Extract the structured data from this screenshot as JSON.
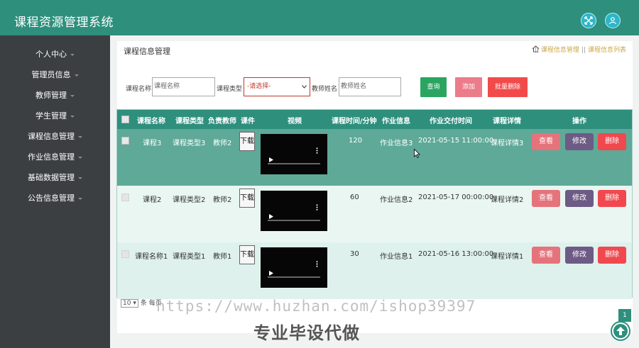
{
  "app": {
    "title": "课程资源管理系统"
  },
  "header": {
    "fullscreen_icon": "expand-icon",
    "user_icon": "user-icon"
  },
  "sidebar": {
    "items": [
      {
        "label": "个人中心"
      },
      {
        "label": "管理员信息"
      },
      {
        "label": "教师管理"
      },
      {
        "label": "学生管理"
      },
      {
        "label": "课程信息管理"
      },
      {
        "label": "作业信息管理"
      },
      {
        "label": "基础数据管理"
      },
      {
        "label": "公告信息管理"
      }
    ]
  },
  "page": {
    "title": "课程信息管理",
    "breadcrumb": [
      "课程信息管理",
      "课程信息列表"
    ]
  },
  "search": {
    "course_name_label": "课程名称",
    "course_name_placeholder": "课程名称",
    "course_type_label": "课程类型",
    "course_type_value": "-请选择-",
    "teacher_label": "教师姓名",
    "teacher_placeholder": "教师姓名",
    "query_label": "查询",
    "add_label": "添加",
    "batch_delete_label": "批量删除"
  },
  "table": {
    "headers": [
      "课程名称",
      "课程类型",
      "负责教师",
      "课件",
      "视频",
      "课程时间/分钟",
      "作业信息",
      "作业交付时间",
      "课程详情",
      "操作"
    ],
    "rows": [
      {
        "name": "课程3",
        "type": "课程类型3",
        "teacher": "教师2",
        "download": "下载",
        "minutes": "120",
        "homework": "作业信息3",
        "deadline": "2021-05-15 11:00:00",
        "detail": "课程详情3",
        "selected": true
      },
      {
        "name": "课程2",
        "type": "课程类型2",
        "teacher": "教师2",
        "download": "下载",
        "minutes": "60",
        "homework": "作业信息2",
        "deadline": "2021-05-17 00:00:00",
        "detail": "课程详情2",
        "selected": false
      },
      {
        "name": "课程名称1",
        "type": "课程类型1",
        "teacher": "教师1",
        "download": "下载",
        "minutes": "30",
        "homework": "作业信息1",
        "deadline": "2021-05-16 13:00:00",
        "detail": "课程详情1",
        "selected": false
      }
    ],
    "actions": {
      "view": "查看",
      "edit": "修改",
      "delete": "删除"
    }
  },
  "pager": {
    "page_size": "10",
    "suffix": "条 每页",
    "current_page": "1"
  },
  "watermark": {
    "url": "https://www.huzhan.com/ishop39397",
    "slogan": "专业毕设代做"
  },
  "colors": {
    "primary": "#2e8f7d",
    "sidebar": "#3b3f42",
    "view": "#e5737c",
    "edit": "#6d5a85",
    "delete": "#f0484e",
    "query": "#2aa561",
    "add": "#ec7c8a",
    "batch_delete": "#f24a4a"
  }
}
